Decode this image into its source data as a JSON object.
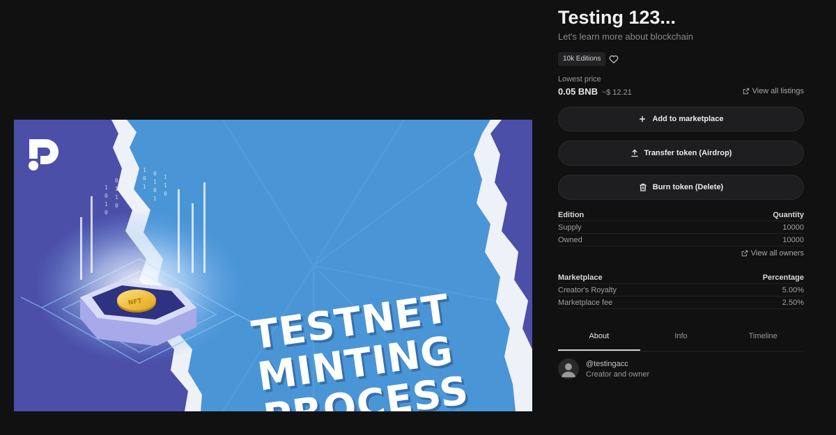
{
  "artwork": {
    "line1": "TESTNET",
    "line2": "MINTING",
    "line3": "PROCESS",
    "coin_label": "NFT"
  },
  "token": {
    "title": "Testing 123...",
    "subtitle": "Let's learn more about blockchain",
    "editions_badge": "10k Editions"
  },
  "price": {
    "label": "Lowest price",
    "value": "0.05 BNB",
    "usd": "~$ 12.21",
    "view_listings": "View all listings"
  },
  "actions": {
    "add": "Add to marketplace",
    "transfer": "Transfer token (Airdrop)",
    "burn": "Burn token (Delete)"
  },
  "edition_table": {
    "headers": [
      "Edition",
      "Quantity"
    ],
    "rows": [
      [
        "Supply",
        "10000"
      ],
      [
        "Owned",
        "10000"
      ]
    ],
    "view_owners": "View all owners"
  },
  "marketplace_table": {
    "headers": [
      "Marketplace",
      "Percentage"
    ],
    "rows": [
      [
        "Creator's Royalty",
        "5.00%"
      ],
      [
        "Marketplace fee",
        "2.50%"
      ]
    ]
  },
  "tabs": [
    {
      "label": "About",
      "active": true
    },
    {
      "label": "Info",
      "active": false
    },
    {
      "label": "Timeline",
      "active": false
    }
  ],
  "owner": {
    "handle": "@testingacc",
    "role": "Creator and owner"
  },
  "colors": {
    "background": "#111112",
    "button_bg": "#1e1e20",
    "art_blue": "#4a95d6",
    "art_purple": "#4b4fa8"
  }
}
